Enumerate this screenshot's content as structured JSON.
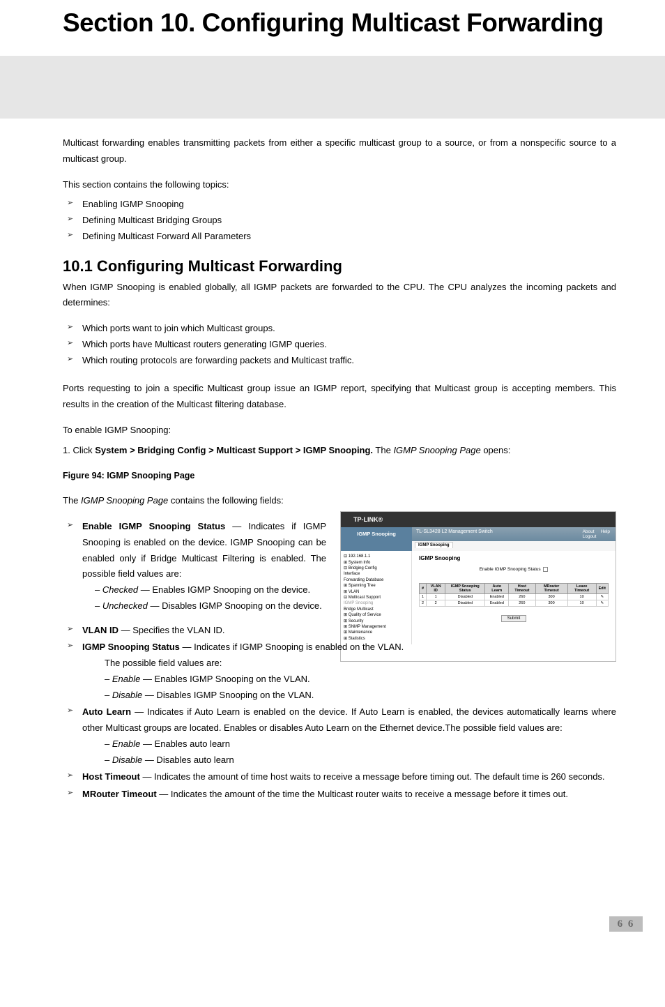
{
  "section_title": "Section 10.  Configuring Multicast Forwarding",
  "intro": "Multicast forwarding enables transmitting packets from either a specific multicast group to a source, or from a nonspecific source to a multicast group.",
  "topics_intro": "This section contains the following topics:",
  "topics": [
    "Enabling IGMP Snooping",
    "Defining Multicast Bridging Groups",
    "Defining Multicast Forward All Parameters"
  ],
  "sub_heading": "10.1   Configuring Multicast Forwarding",
  "sub_p1": "When IGMP Snooping is enabled globally, all IGMP packets are forwarded to the CPU. The CPU analyzes the incoming packets and determines:",
  "sub_bullets": [
    "Which ports want to join which Multicast groups.",
    "Which ports have Multicast routers generating IGMP queries.",
    "Which routing protocols are forwarding packets and Multicast traffic."
  ],
  "sub_p2": "Ports requesting to join a specific Multicast group issue an IGMP report, specifying that Multicast group is accepting members. This results in the creation of the Multicast filtering database.",
  "enable_intro": "To enable IGMP Snooping:",
  "step1_prefix": "1.  Click ",
  "step1_bold": "System > Bridging Config > Multicast Support > IGMP Snooping.",
  "step1_mid": " The ",
  "step1_italic": "IGMP Snooping Page",
  "step1_suffix": " opens:",
  "figure_caption": "Figure 94: IGMP Snooping Page",
  "page_contains_prefix": "The ",
  "page_contains_italic": "IGMP Snooping Page",
  "page_contains_suffix": " contains the following fields:",
  "fields": {
    "enable_status": {
      "label": "Enable IGMP Snooping Status",
      "desc": " — Indicates if IGMP Snooping is enabled on the device. IGMP Snooping can be enabled only if Bridge Multicast Filtering is enabled. The possible field values are:",
      "checked_label": "Checked",
      "checked_desc": " — Enables IGMP Snooping on the device.",
      "unchecked_label": "Unchecked",
      "unchecked_desc": " — Disables IGMP Snooping on the device."
    },
    "vlan_id": {
      "label": "VLAN ID",
      "desc": " — Specifies the VLAN ID."
    },
    "snoop_status": {
      "label": "IGMP Snooping Status",
      "desc": " — Indicates if IGMP Snooping is enabled on the VLAN.",
      "sub_intro": "The possible field values are:",
      "enable_label": "Enable",
      "enable_desc": " — Enables IGMP Snooping on the VLAN.",
      "disable_label": "Disable",
      "disable_desc": " — Disables IGMP Snooping on the VLAN."
    },
    "auto_learn": {
      "label": "Auto Learn",
      "desc": " — Indicates if Auto Learn is enabled on the device. If Auto Learn is enabled, the devices automatically learns where other Multicast groups are located. Enables or disables Auto Learn on the Ethernet device.The possible field values are:",
      "enable_label": "Enable",
      "enable_desc": " — Enables auto learn",
      "disable_label": "Disable",
      "disable_desc": " — Disables auto learn"
    },
    "host_timeout": {
      "label": "Host Timeout",
      "desc": " — Indicates the amount of time host waits to receive a message before timing out. The default time is 260 seconds."
    },
    "mrouter_timeout": {
      "label": "MRouter Timeout",
      "desc": " — Indicates the amount of the time the Multicast router waits to receive a message before it times out."
    }
  },
  "screenshot": {
    "brand": "TP-LINK®",
    "page_label": "IGMP Snooping",
    "banner_title": "TL-SL3428 L2 Management Switch",
    "banner_right": [
      "About",
      "Help",
      "Logout"
    ],
    "tab": "IGMP Snooping",
    "tree": [
      "⊟ 192.168.1.1",
      "  ⊞ System Info",
      "  ⊟ Bridging Config",
      "      Interface",
      "      Forwarding Database",
      "    ⊞ Spanning Tree",
      "    ⊞ VLAN",
      "    ⊟ Multicast Support",
      "        IGMP Snooping",
      "        Bridge Multicast",
      "  ⊞ Quality of Service",
      "  ⊞ Security",
      "  ⊞ SNMP Management",
      "  ⊞ Maintenance",
      "  ⊞ Statistics"
    ],
    "main_heading": "IGMP Snooping",
    "enable_label": "Enable IGMP Snooping Status",
    "table_headers": [
      "#",
      "VLAN ID",
      "IGMP Snooping Status",
      "Auto Learn",
      "Host Timeout",
      "MRouter Timeout",
      "Leave Timeout",
      "Edit"
    ],
    "rows": [
      [
        "1",
        "1",
        "Disabled",
        "Enabled",
        "260",
        "300",
        "10",
        "✎"
      ],
      [
        "2",
        "2",
        "Disabled",
        "Enabled",
        "260",
        "300",
        "10",
        "✎"
      ]
    ],
    "submit": "Submit"
  },
  "page_number": "6 6"
}
